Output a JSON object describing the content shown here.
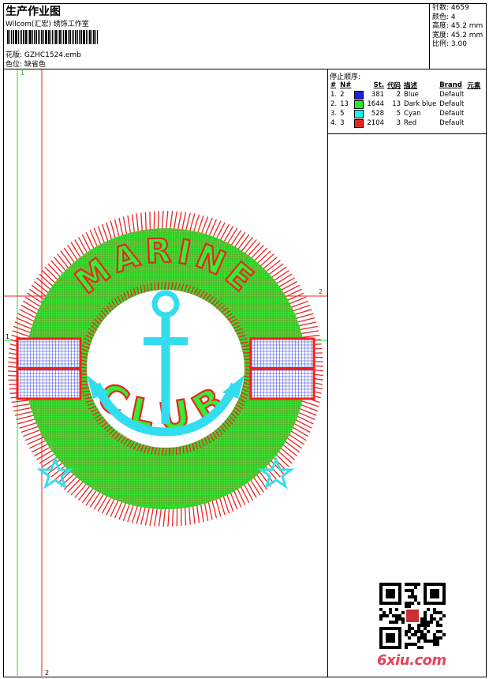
{
  "header": {
    "title": "生产作业图",
    "company": "Wilcom(汇宏) 绣饰工作室",
    "pattern_label": "花版:",
    "pattern_value": "GZHC1524.emb",
    "color_label": "色位:",
    "color_value": "缺省色"
  },
  "stats": {
    "stitches": "针数: 4659",
    "colors": "颜色: 4",
    "height": "高度: 45.2 mm",
    "width": "宽度: 45.2 mm",
    "scale": "比例: 3.00"
  },
  "stop_sequence": {
    "title": "停止顺序:",
    "headers": [
      "#",
      "N#",
      "St.",
      "代码",
      "描述",
      "Brand",
      "元素"
    ],
    "rows": [
      {
        "num": "1.",
        "n": "2",
        "color": "#2222dd",
        "st": "381",
        "code": "2",
        "desc": "Blue",
        "brand": "Default"
      },
      {
        "num": "2.",
        "n": "13",
        "color": "#22ee22",
        "st": "1644",
        "code": "13",
        "desc": "Dark blue",
        "brand": "Default"
      },
      {
        "num": "3.",
        "n": "5",
        "color": "#22eeee",
        "st": "528",
        "code": "5",
        "desc": "Cyan",
        "brand": "Default"
      },
      {
        "num": "4.",
        "n": "3",
        "color": "#ee2222",
        "st": "2104",
        "code": "3",
        "desc": "Red",
        "brand": "Default"
      }
    ]
  },
  "design": {
    "top_text": "MARINE",
    "bottom_text": "CLUB",
    "guide_labels": {
      "v1": "1",
      "v2": "2",
      "h1": "1",
      "h2": "2"
    },
    "colors": {
      "outline": "#ee2222",
      "fill": "#33ee33",
      "band": "#2233dd",
      "anchor": "#33ddee"
    }
  },
  "watermark": "6xiu.com"
}
